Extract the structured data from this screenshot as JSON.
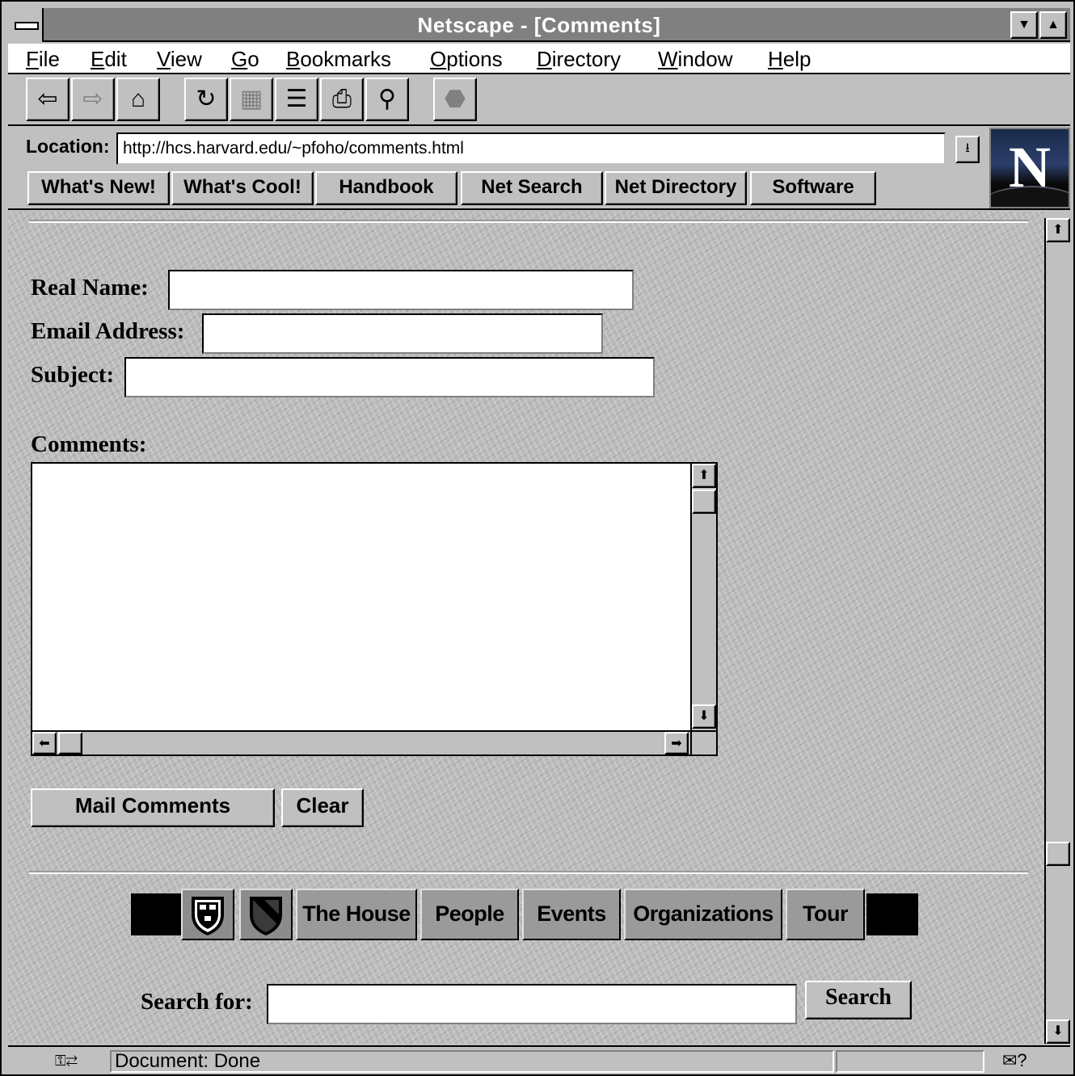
{
  "window": {
    "title": "Netscape - [Comments]"
  },
  "menu": [
    {
      "key": "F",
      "rest": "ile"
    },
    {
      "key": "E",
      "rest": "dit"
    },
    {
      "key": "V",
      "rest": "iew"
    },
    {
      "key": "G",
      "rest": "o"
    },
    {
      "key": "B",
      "rest": "ookmarks"
    },
    {
      "key": "O",
      "rest": "ptions"
    },
    {
      "key": "D",
      "rest": "irectory"
    },
    {
      "key": "W",
      "rest": "indow"
    },
    {
      "key": "H",
      "rest": "elp"
    }
  ],
  "toolbar": {
    "icons": [
      "back-icon",
      "forward-icon",
      "home-icon",
      "reload-icon",
      "images-icon",
      "open-icon",
      "print-icon",
      "find-icon",
      "stop-icon"
    ]
  },
  "location": {
    "label": "Location:",
    "url": "http://hcs.harvard.edu/~pfoho/comments.html"
  },
  "directory_buttons": [
    "What's New!",
    "What's Cool!",
    "Handbook",
    "Net Search",
    "Net Directory",
    "Software"
  ],
  "form": {
    "real_name_label": "Real Name:",
    "email_label": "Email Address:",
    "subject_label": "Subject:",
    "comments_label": "Comments:",
    "real_name_value": "",
    "email_value": "",
    "subject_value": "",
    "comments_value": "",
    "mail_button": "Mail Comments",
    "clear_button": "Clear"
  },
  "site_nav": [
    "The House",
    "People",
    "Events",
    "Organizations",
    "Tour"
  ],
  "search": {
    "label": "Search for:",
    "value": "",
    "button": "Search"
  },
  "status": {
    "text": "Document: Done"
  },
  "colors": {
    "chrome": "#c0c0c0",
    "titlebar": "#808080",
    "content_bg": "#bdbdbd"
  }
}
